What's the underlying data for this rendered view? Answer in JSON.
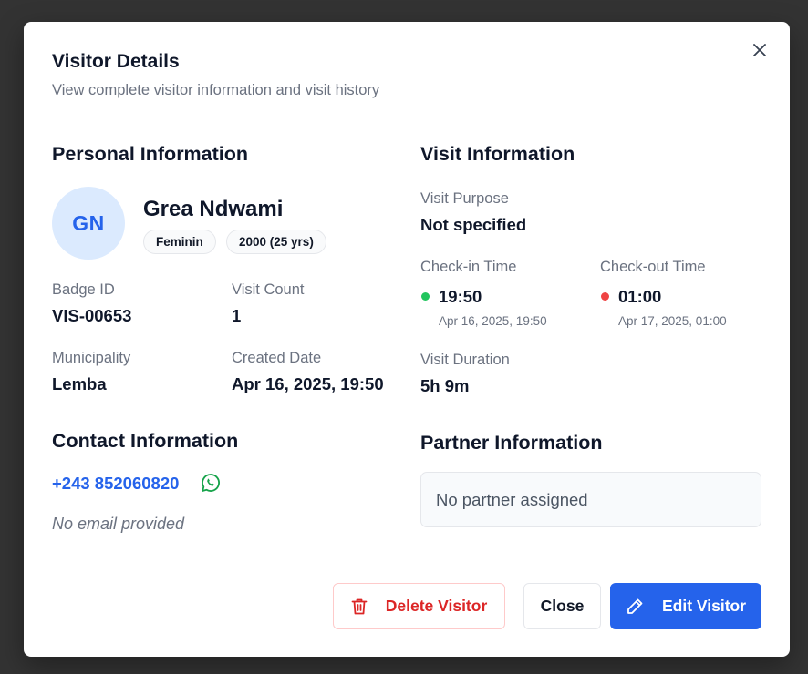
{
  "dialog": {
    "title": "Visitor Details",
    "subtitle": "View complete visitor information and visit history",
    "close_icon": "close-icon"
  },
  "personal": {
    "section_title": "Personal Information",
    "initials": "GN",
    "name": "Grea Ndwami",
    "gender": "Feminin",
    "birth": "2000 (25 yrs)",
    "badge_label": "Badge ID",
    "badge_value": "VIS-00653",
    "visit_count_label": "Visit Count",
    "visit_count_value": "1",
    "municipality_label": "Municipality",
    "municipality_value": "Lemba",
    "created_label": "Created Date",
    "created_value": "Apr 16, 2025, 19:50"
  },
  "contact": {
    "section_title": "Contact Information",
    "phone": "+243 852060820",
    "whatsapp_icon": "whatsapp-icon",
    "email": "No email provided"
  },
  "visit": {
    "section_title": "Visit Information",
    "purpose_label": "Visit Purpose",
    "purpose_value": "Not specified",
    "checkin_label": "Check-in Time",
    "checkin_time": "19:50",
    "checkin_date": "Apr 16, 2025, 19:50",
    "checkout_label": "Check-out Time",
    "checkout_time": "01:00",
    "checkout_date": "Apr 17, 2025, 01:00",
    "duration_label": "Visit Duration",
    "duration_value": "5h 9m"
  },
  "partner": {
    "section_title": "Partner Information",
    "empty_text": "No partner assigned"
  },
  "actions": {
    "delete_label": "Delete Visitor",
    "close_label": "Close",
    "edit_label": "Edit Visitor"
  },
  "colors": {
    "primary": "#2563eb",
    "danger": "#dc2626",
    "checkin_dot": "#22c55e",
    "checkout_dot": "#ef4444",
    "whatsapp": "#16a34a"
  }
}
